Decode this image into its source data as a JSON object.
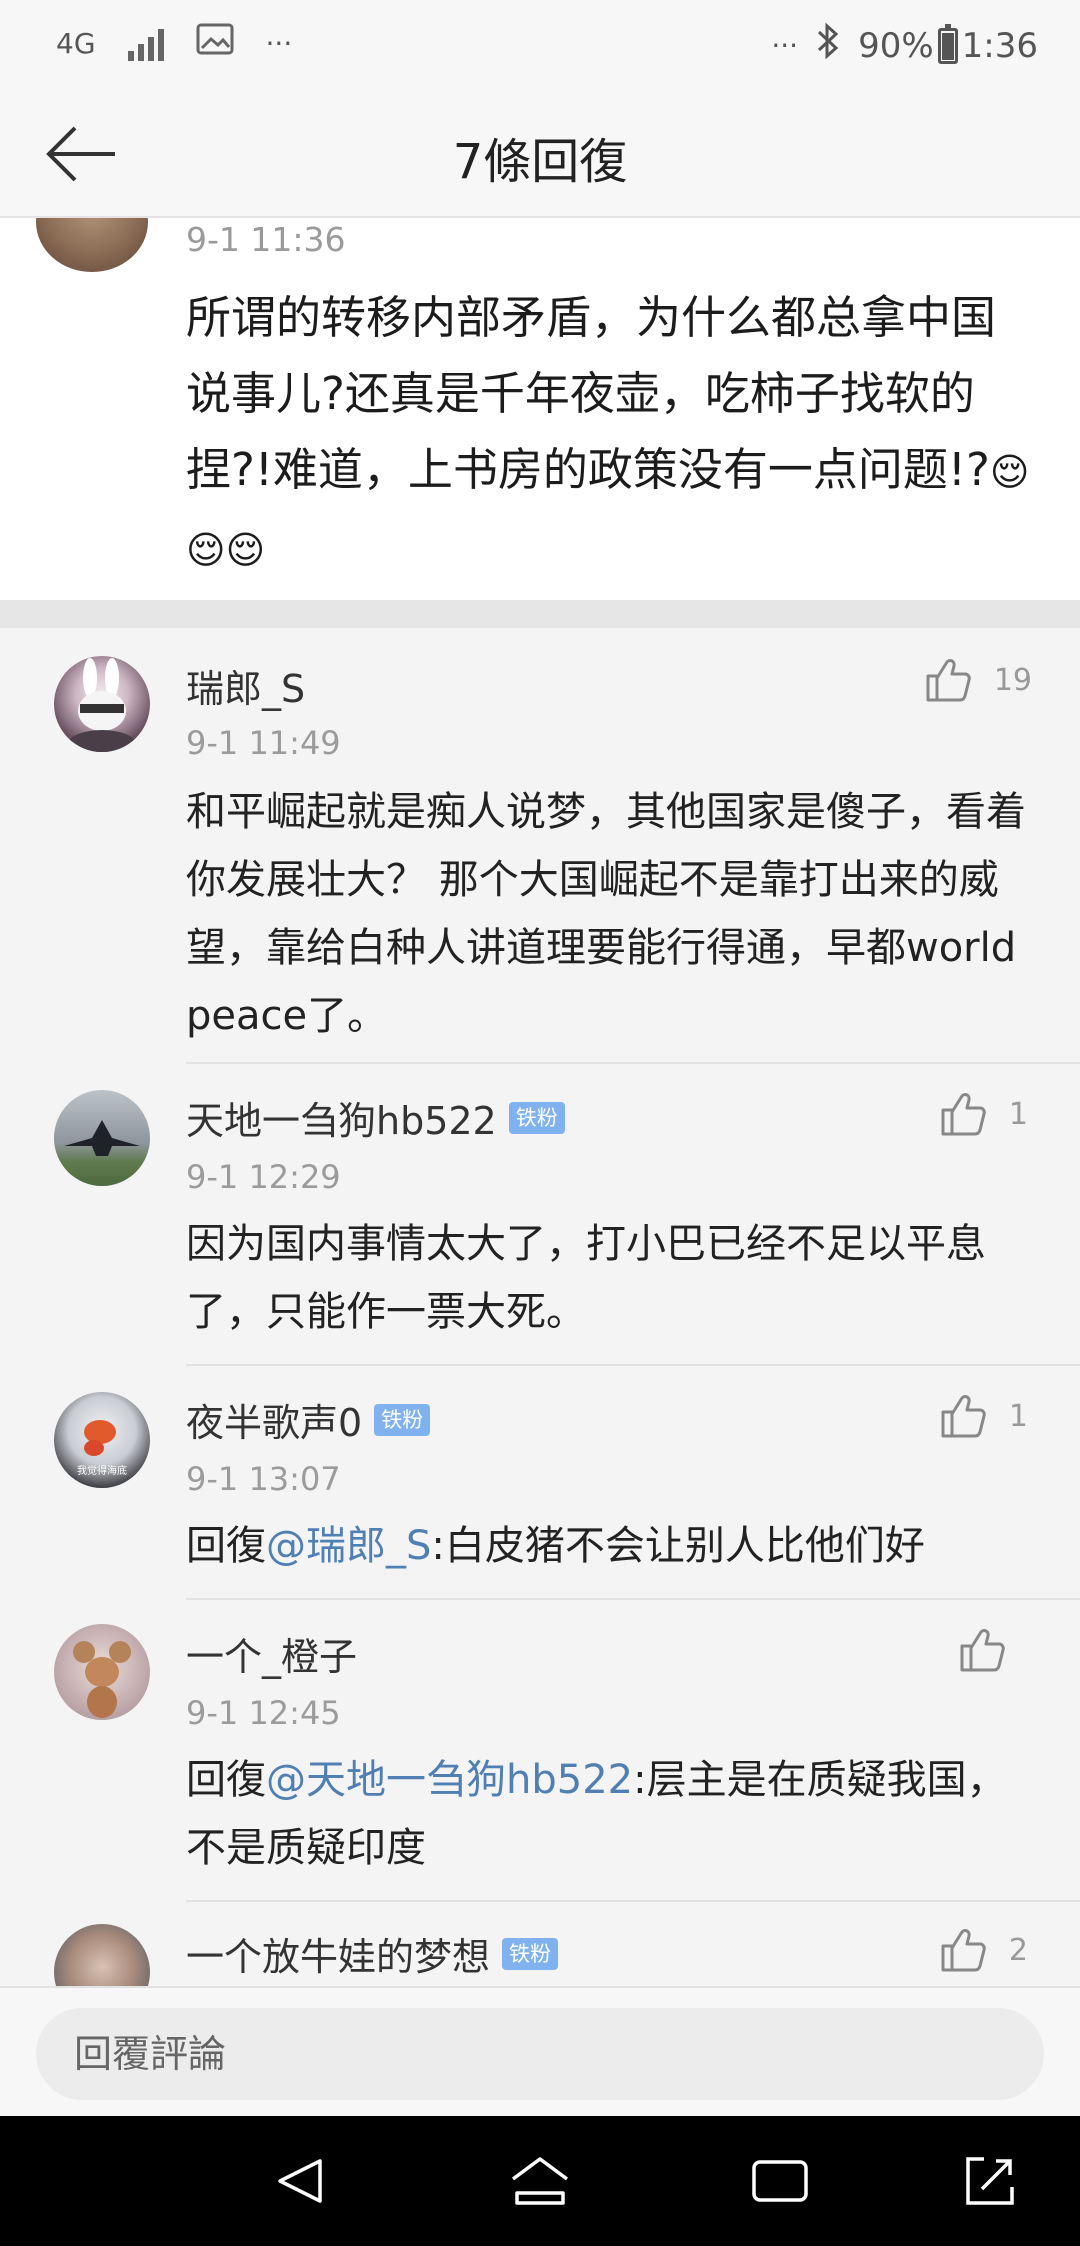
{
  "status_bar": {
    "network": "4G",
    "more": "···",
    "more_right": "···",
    "battery": "90%",
    "time": "1:36"
  },
  "header": {
    "title": "7條回復"
  },
  "main_post": {
    "time": "9-1 11:36",
    "text": "所谓的转移内部矛盾，为什么都总拿中国说事儿?还真是千年夜壶，吃柿子找软的捏?!难道，上书房的政策没有一点问题!?",
    "emoji": "😌😌😌"
  },
  "replies": [
    {
      "username": "瑞郎_S",
      "badge": "",
      "time": "9-1 11:49",
      "likes": "19",
      "prefix": "",
      "mention": "",
      "text": "和平崛起就是痴人说梦，其他国家是傻子，看着你发展壮大？ 那个大国崛起不是靠打出来的威望，靠给白种人讲道理要能行得通，早都world peace了。"
    },
    {
      "username": "天地一刍狗hb522",
      "badge": "铁粉",
      "time": "9-1 12:29",
      "likes": "1",
      "prefix": "",
      "mention": "",
      "text": "因为国内事情太大了，打小巴已经不足以平息了，只能作一票大死。"
    },
    {
      "username": "夜半歌声0",
      "badge": "铁粉",
      "time": "9-1 13:07",
      "likes": "1",
      "prefix": "回復",
      "mention": "@瑞郎_S",
      "text": ":白皮猪不会让别人比他们好"
    },
    {
      "username": "一个_橙子",
      "badge": "",
      "time": "9-1 12:45",
      "likes": "",
      "prefix": "回復",
      "mention": "@天地一刍狗hb522",
      "text": ":层主是在质疑我国，不是质疑印度"
    },
    {
      "username": "一个放牛娃的梦想",
      "badge": "铁粉",
      "time": "",
      "likes": "2",
      "prefix": "",
      "mention": "",
      "text": ""
    }
  ],
  "avatar_captions": {
    "reply_3": "我觉得海底"
  },
  "reply_bar": {
    "placeholder": "回覆評論"
  },
  "colors": {
    "mention": "#4f7fb3",
    "badge": "#7fb2ee",
    "background": "#f4f4f4"
  },
  "icons": {
    "back": "arrow-left-icon",
    "like": "thumbs-up-icon",
    "nav_back": "triangle-back-icon",
    "nav_home": "home-icon",
    "nav_recents": "recents-icon",
    "nav_expand": "expand-icon"
  }
}
